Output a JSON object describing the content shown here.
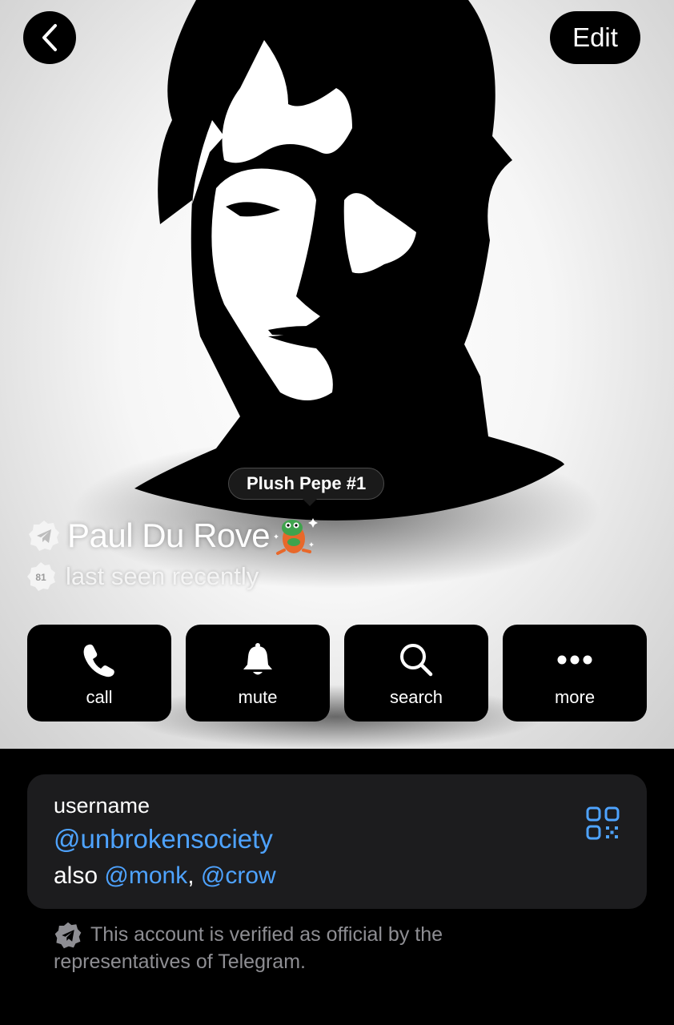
{
  "header": {
    "back_icon": "chevron-left-icon",
    "edit_label": "Edit"
  },
  "profile": {
    "gift_tooltip": "Plush Pepe #1",
    "name": "Paul Du Rove",
    "verified_icon": "telegram-verified-badge-icon",
    "status": "last seen recently",
    "level_badge": "81",
    "emoji_status": "plush-pepe-sticker"
  },
  "actions": [
    {
      "label": "call",
      "icon": "phone-icon"
    },
    {
      "label": "mute",
      "icon": "bell-icon"
    },
    {
      "label": "search",
      "icon": "search-icon"
    },
    {
      "label": "more",
      "icon": "more-dots-icon"
    }
  ],
  "info": {
    "username_label": "username",
    "username": "@unbrokensociety",
    "also_prefix": "also",
    "also_1": "@monk",
    "separator": ",",
    "also_2": "@crow",
    "qr_icon": "qr-code-icon"
  },
  "verification_note": "This account is verified as official by the representatives of Telegram.",
  "colors": {
    "link": "#4ea3ff",
    "card_bg": "#1c1c1e",
    "muted_text": "#8e8e93",
    "button_bg": "#000000"
  }
}
